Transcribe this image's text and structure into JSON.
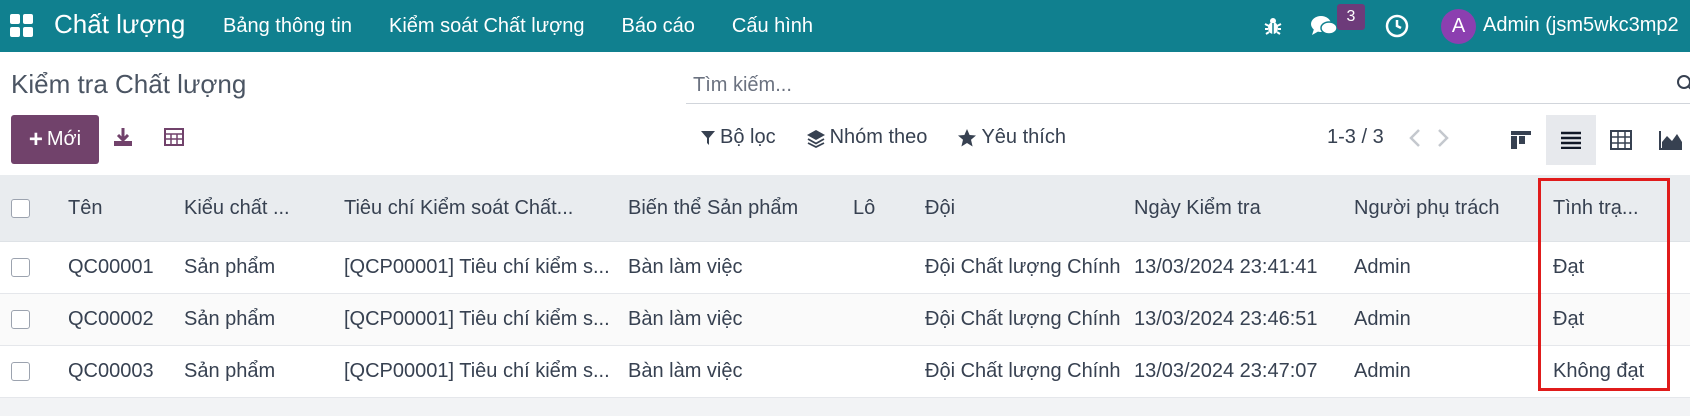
{
  "navbar": {
    "app_title": "Chất lượng",
    "menu": [
      "Bảng thông tin",
      "Kiểm soát Chất lượng",
      "Báo cáo",
      "Cấu hình"
    ],
    "chat_badge": "3",
    "avatar_letter": "A",
    "user_name": "Admin (jsm5wkc3mp2",
    "color": "#10808f"
  },
  "control": {
    "page_title": "Kiểm tra Chất lượng",
    "new_label": "Mới",
    "search_placeholder": "Tìm kiếm...",
    "filter_label": "Bộ lọc",
    "groupby_label": "Nhóm theo",
    "favorites_label": "Yêu thích",
    "pager": "1-3 / 3",
    "accent": "#71426b"
  },
  "table": {
    "headers": [
      "Tên",
      "Kiểu chất ...",
      "Tiêu chí Kiểm soát Chất...",
      "Biến thể Sản phẩm",
      "Lô",
      "Đội",
      "Ngày Kiểm tra",
      "Người phụ trách",
      "Tình trạ..."
    ],
    "rows": [
      {
        "name": "QC00001",
        "type": "Sản phẩm",
        "point": "[QCP00001] Tiêu chí kiểm s...",
        "variant": "Bàn làm việc",
        "lot": "",
        "team": "Đội Chất lượng Chính",
        "date": "13/03/2024 23:41:41",
        "owner": "Admin",
        "status": "Đạt"
      },
      {
        "name": "QC00002",
        "type": "Sản phẩm",
        "point": "[QCP00001] Tiêu chí kiểm s...",
        "variant": "Bàn làm việc",
        "lot": "",
        "team": "Đội Chất lượng Chính",
        "date": "13/03/2024 23:46:51",
        "owner": "Admin",
        "status": "Đạt"
      },
      {
        "name": "QC00003",
        "type": "Sản phẩm",
        "point": "[QCP00001] Tiêu chí kiểm s...",
        "variant": "Bàn làm việc",
        "lot": "",
        "team": "Đội Chất lượng Chính",
        "date": "13/03/2024 23:47:07",
        "owner": "Admin",
        "status": "Không đạt"
      }
    ],
    "highlight_color": "#e01b1b"
  }
}
